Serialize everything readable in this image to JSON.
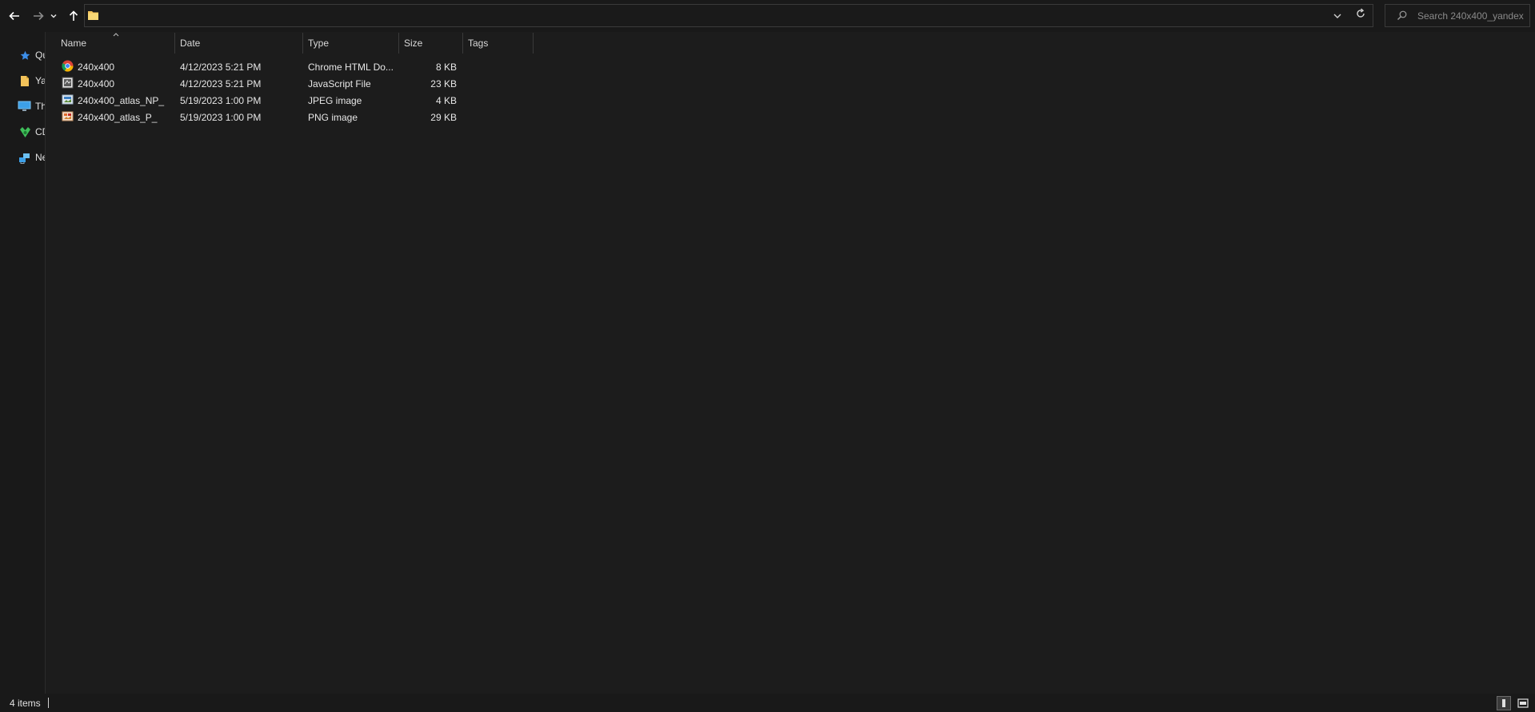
{
  "nav": {
    "back_icon": "arrow-left-icon",
    "forward_icon": "arrow-right-icon",
    "recent_icon": "chevron-down-icon",
    "up_icon": "arrow-up-icon"
  },
  "address": {
    "path": "",
    "folder_icon": "folder-icon",
    "dropdown_icon": "chevron-down-icon",
    "refresh_icon": "refresh-icon"
  },
  "search": {
    "placeholder": "Search 240x400_yandex"
  },
  "sidebar": {
    "items": [
      {
        "label": "Qu",
        "icon": "star-icon"
      },
      {
        "label": "Ya",
        "icon": "folder-icon"
      },
      {
        "label": "Th",
        "icon": "monitor-icon"
      },
      {
        "label": "CD",
        "icon": "cd-drive-icon"
      },
      {
        "label": "Ne",
        "icon": "network-icon"
      }
    ]
  },
  "columns": {
    "name": "Name",
    "date": "Date",
    "type": "Type",
    "size": "Size",
    "tags": "Tags"
  },
  "files": [
    {
      "name": "240x400",
      "date": "4/12/2023 5:21 PM",
      "type": "Chrome HTML Do...",
      "size": "8 KB",
      "icon": "chrome-icon"
    },
    {
      "name": "240x400",
      "date": "4/12/2023 5:21 PM",
      "type": "JavaScript File",
      "size": "23 KB",
      "icon": "javascript-file-icon"
    },
    {
      "name": "240x400_atlas_NP_",
      "date": "5/19/2023 1:00 PM",
      "type": "JPEG image",
      "size": "4 KB",
      "icon": "jpeg-image-icon"
    },
    {
      "name": "240x400_atlas_P_",
      "date": "5/19/2023 1:00 PM",
      "type": "PNG image",
      "size": "29 KB",
      "icon": "png-image-icon"
    }
  ],
  "status": {
    "item_count": "4 items",
    "details_view_icon": "details-view-icon",
    "preview_view_icon": "large-icons-view-icon"
  },
  "colors": {
    "background": "#191919",
    "content_background": "#1c1c1c",
    "folder_yellow": "#f3c35a",
    "text": "#e6e6e6"
  }
}
